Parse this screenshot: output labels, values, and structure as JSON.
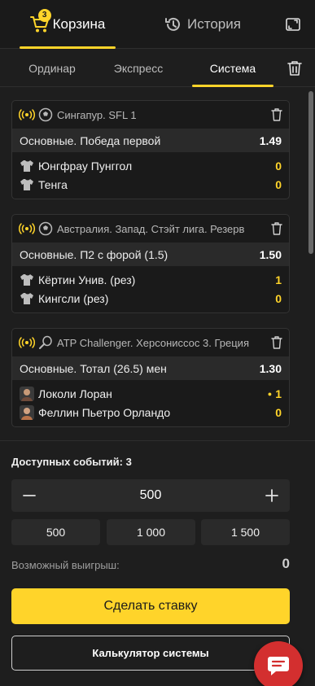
{
  "colors": {
    "accent": "#ffd42a",
    "background": "#1e1e1e",
    "card": "#1a1a1a",
    "market_row": "#2a2a2a",
    "chat": "#d32f2f"
  },
  "top_tabs": {
    "cart_label": "Корзина",
    "cart_badge": "3",
    "history_label": "История"
  },
  "sub_tabs": [
    {
      "label": "Ординар",
      "active": false
    },
    {
      "label": "Экспресс",
      "active": false
    },
    {
      "label": "Система",
      "active": true
    }
  ],
  "bets": [
    {
      "sport_icon": "football-icon",
      "league": "Сингапур. SFL 1",
      "market": "Основные. Победа первой",
      "odd": "1.49",
      "teams": [
        {
          "icon": "jersey-icon",
          "name": "Юнгфрау Пунггол",
          "score": "0",
          "serving": false
        },
        {
          "icon": "jersey-icon",
          "name": "Тенга",
          "score": "0",
          "serving": false
        }
      ]
    },
    {
      "sport_icon": "football-icon",
      "league": "Австралия. Запад. Стэйт лига. Резерв",
      "market": "Основные. П2 с форой (1.5)",
      "odd": "1.50",
      "teams": [
        {
          "icon": "jersey-icon",
          "name": "Кёртин Унив. (рез)",
          "score": "1",
          "serving": false
        },
        {
          "icon": "jersey-icon",
          "name": "Кингсли (рез)",
          "score": "0",
          "serving": false
        }
      ]
    },
    {
      "sport_icon": "tennis-icon",
      "league": "ATP Challenger. Херсониссос 3. Греция",
      "market": "Основные. Тотал (26.5) мен",
      "odd": "1.30",
      "teams": [
        {
          "icon": "player-avatar-icon",
          "name": "Локоли Лоран",
          "score": "1",
          "serving": true
        },
        {
          "icon": "player-avatar-icon",
          "name": "Феллин Пьетро Орландо",
          "score": "0",
          "serving": false
        }
      ]
    }
  ],
  "summary": {
    "available_events": "Доступных событий: 3",
    "stake_value": "500",
    "quick_amounts": [
      "500",
      "1 000",
      "1 500"
    ],
    "possible_win_label": "Возможный выигрыш:",
    "possible_win_value": "0",
    "place_bet_label": "Сделать ставку",
    "calculator_label": "Калькулятор системы"
  }
}
